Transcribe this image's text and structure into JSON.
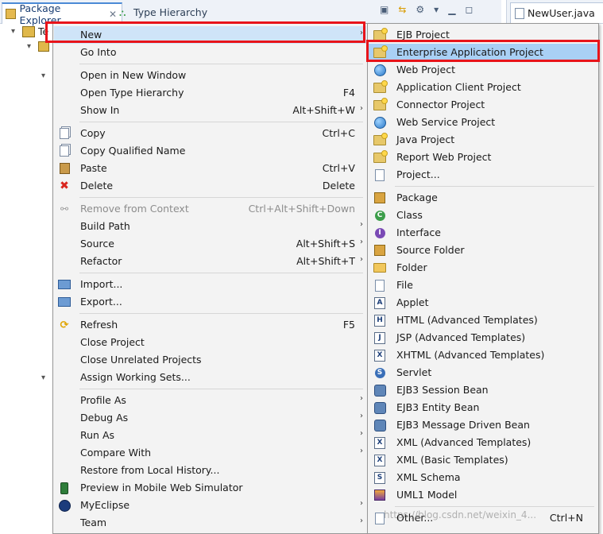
{
  "tabs": {
    "package_explorer": "Package Explorer",
    "type_hierarchy": "Type Hierarchy",
    "editor": "NewUser.java"
  },
  "tree": {
    "root_label_fragment": "Te"
  },
  "context_menu": {
    "items": [
      {
        "label": "New",
        "shortcut": "",
        "submenu": true,
        "highlighted": true,
        "icon": "none"
      },
      {
        "label": "Go Into",
        "shortcut": "",
        "submenu": false,
        "icon": "none"
      },
      {
        "label": "Open in New Window",
        "shortcut": "",
        "submenu": false,
        "icon": "none"
      },
      {
        "label": "Open Type Hierarchy",
        "shortcut": "F4",
        "submenu": false,
        "icon": "none"
      },
      {
        "label": "Show In",
        "shortcut": "Alt+Shift+W",
        "submenu": true,
        "icon": "none"
      },
      {
        "label": "Copy",
        "shortcut": "Ctrl+C",
        "submenu": false,
        "icon": "copy-icon"
      },
      {
        "label": "Copy Qualified Name",
        "shortcut": "",
        "submenu": false,
        "icon": "copy-icon"
      },
      {
        "label": "Paste",
        "shortcut": "Ctrl+V",
        "submenu": false,
        "icon": "paste-icon"
      },
      {
        "label": "Delete",
        "shortcut": "Delete",
        "submenu": false,
        "icon": "delete-icon"
      },
      {
        "label": "Remove from Context",
        "shortcut": "Ctrl+Alt+Shift+Down",
        "submenu": false,
        "disabled": true,
        "icon": "remove-context-icon"
      },
      {
        "label": "Build Path",
        "shortcut": "",
        "submenu": true,
        "icon": "none"
      },
      {
        "label": "Source",
        "shortcut": "Alt+Shift+S",
        "submenu": true,
        "icon": "none"
      },
      {
        "label": "Refactor",
        "shortcut": "Alt+Shift+T",
        "submenu": true,
        "icon": "none"
      },
      {
        "label": "Import...",
        "shortcut": "",
        "submenu": false,
        "icon": "import-icon"
      },
      {
        "label": "Export...",
        "shortcut": "",
        "submenu": false,
        "icon": "export-icon"
      },
      {
        "label": "Refresh",
        "shortcut": "F5",
        "submenu": false,
        "icon": "refresh-icon"
      },
      {
        "label": "Close Project",
        "shortcut": "",
        "submenu": false,
        "icon": "none"
      },
      {
        "label": "Close Unrelated Projects",
        "shortcut": "",
        "submenu": false,
        "icon": "none"
      },
      {
        "label": "Assign Working Sets...",
        "shortcut": "",
        "submenu": false,
        "icon": "none"
      },
      {
        "label": "Profile As",
        "shortcut": "",
        "submenu": true,
        "icon": "none"
      },
      {
        "label": "Debug As",
        "shortcut": "",
        "submenu": true,
        "icon": "none"
      },
      {
        "label": "Run As",
        "shortcut": "",
        "submenu": true,
        "icon": "none"
      },
      {
        "label": "Compare With",
        "shortcut": "",
        "submenu": true,
        "icon": "none"
      },
      {
        "label": "Restore from Local History...",
        "shortcut": "",
        "submenu": false,
        "icon": "none"
      },
      {
        "label": "Preview in Mobile Web Simulator",
        "shortcut": "",
        "submenu": false,
        "icon": "mobile-icon"
      },
      {
        "label": "MyEclipse",
        "shortcut": "",
        "submenu": true,
        "icon": "myeclipse-icon"
      },
      {
        "label": "Team",
        "shortcut": "",
        "submenu": true,
        "icon": "none"
      }
    ]
  },
  "new_submenu": {
    "items": [
      {
        "label": "EJB Project",
        "icon": "ejb-project-icon"
      },
      {
        "label": "Enterprise Application Project",
        "icon": "enterprise-project-icon",
        "highlighted": true
      },
      {
        "label": "Web Project",
        "icon": "web-project-icon"
      },
      {
        "label": "Application Client Project",
        "icon": "client-project-icon"
      },
      {
        "label": "Connector Project",
        "icon": "connector-project-icon"
      },
      {
        "label": "Web Service Project",
        "icon": "web-service-project-icon"
      },
      {
        "label": "Java Project",
        "icon": "java-project-icon"
      },
      {
        "label": "Report Web Project",
        "icon": "report-project-icon"
      },
      {
        "label": "Project...",
        "icon": "project-icon"
      },
      {
        "label": "Package",
        "icon": "package-icon"
      },
      {
        "label": "Class",
        "icon": "class-icon"
      },
      {
        "label": "Interface",
        "icon": "interface-icon"
      },
      {
        "label": "Source Folder",
        "icon": "source-folder-icon"
      },
      {
        "label": "Folder",
        "icon": "folder-icon"
      },
      {
        "label": "File",
        "icon": "file-icon"
      },
      {
        "label": "Applet",
        "icon": "applet-icon"
      },
      {
        "label": "HTML (Advanced Templates)",
        "icon": "html-icon"
      },
      {
        "label": "JSP (Advanced Templates)",
        "icon": "jsp-icon"
      },
      {
        "label": "XHTML (Advanced Templates)",
        "icon": "xhtml-icon"
      },
      {
        "label": "Servlet",
        "icon": "servlet-icon"
      },
      {
        "label": "EJB3 Session Bean",
        "icon": "session-bean-icon"
      },
      {
        "label": "EJB3 Entity Bean",
        "icon": "entity-bean-icon"
      },
      {
        "label": "EJB3 Message Driven Bean",
        "icon": "message-bean-icon"
      },
      {
        "label": "XML (Advanced Templates)",
        "icon": "xml-advanced-icon"
      },
      {
        "label": "XML (Basic Templates)",
        "icon": "xml-basic-icon"
      },
      {
        "label": "XML Schema",
        "icon": "xml-schema-icon"
      },
      {
        "label": "UML1 Model",
        "icon": "uml-icon"
      },
      {
        "label": "Other...",
        "shortcut": "Ctrl+N",
        "icon": "other-icon"
      }
    ]
  },
  "watermark": "https://blog.csdn.net/weixin_4..."
}
